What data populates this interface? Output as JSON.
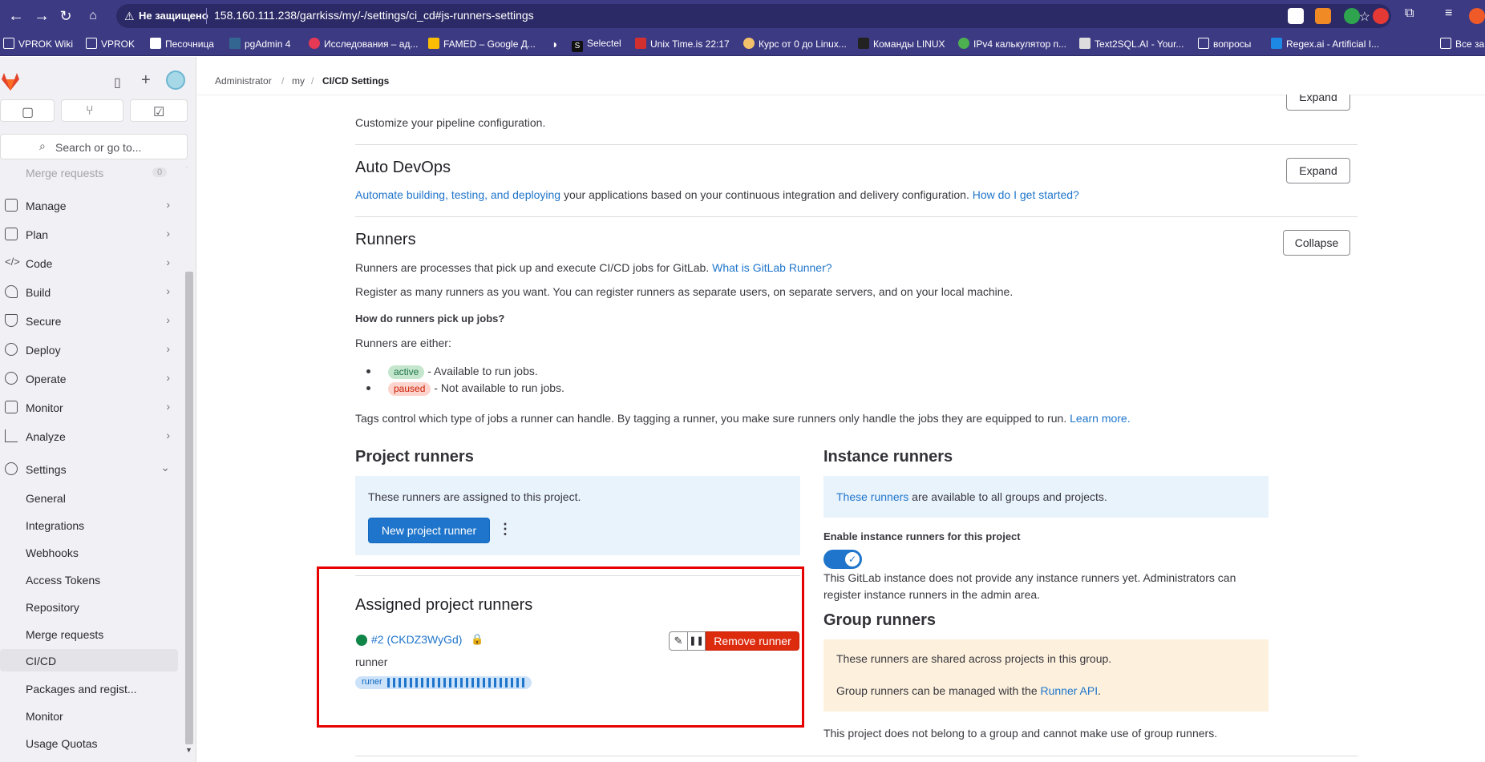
{
  "browser": {
    "security_label": "Не защищено",
    "url": "158.160.111.238/garrkiss/my/-/settings/ci_cd#js-runners-settings",
    "bookmarks": [
      "VPROK Wiki",
      "VPROK",
      "Песочница",
      "pgAdmin 4",
      "Исследования – ад...",
      "FAMED – Google Д...",
      "Selectel",
      "Unix Time.is 22:17",
      "Курс от 0 до Linux...",
      "Команды LINUX",
      "IPv4 калькулятор п...",
      "Text2SQL.AI - Your...",
      "вопросы",
      "Regex.ai - Artificial I...",
      "Все за"
    ]
  },
  "sidebar": {
    "search_placeholder": "Search or go to...",
    "partial_item": "Merge requests",
    "partial_count": "0",
    "items": [
      {
        "label": "Manage",
        "icon": "users-icon"
      },
      {
        "label": "Plan",
        "icon": "calendar-icon"
      },
      {
        "label": "Code",
        "icon": "code-icon"
      },
      {
        "label": "Build",
        "icon": "rocket-icon"
      },
      {
        "label": "Secure",
        "icon": "shield-icon"
      },
      {
        "label": "Deploy",
        "icon": "deploy-icon"
      },
      {
        "label": "Operate",
        "icon": "cloud-icon"
      },
      {
        "label": "Monitor",
        "icon": "monitor-icon"
      },
      {
        "label": "Analyze",
        "icon": "chart-icon"
      },
      {
        "label": "Settings",
        "icon": "gear-icon"
      }
    ],
    "settings_sub": [
      "General",
      "Integrations",
      "Webhooks",
      "Access Tokens",
      "Repository",
      "Merge requests",
      "CI/CD",
      "Packages and regist...",
      "Monitor",
      "Usage Quotas"
    ],
    "active_sub": "CI/CD"
  },
  "breadcrumb": {
    "a": "Administrator",
    "b": "my",
    "c": "CI/CD Settings"
  },
  "general_pipelines": {
    "desc": "Customize your pipeline configuration.",
    "button": "Expand"
  },
  "autodevops": {
    "title": "Auto DevOps",
    "link1": "Automate building, testing, and deploying",
    "text": " your applications based on your continuous integration and delivery configuration. ",
    "link2": "How do I get started?",
    "button": "Expand"
  },
  "runners": {
    "title": "Runners",
    "button": "Collapse",
    "p1": "Runners are processes that pick up and execute CI/CD jobs for GitLab. ",
    "p1_link": "What is GitLab Runner?",
    "p2": "Register as many runners as you want. You can register runners as separate users, on separate servers, and on your local machine.",
    "how_title": "How do runners pick up jobs?",
    "either": "Runners are either:",
    "active_badge": "active",
    "active_text": " - Available to run jobs.",
    "paused_badge": "paused",
    "paused_text": " - Not available to run jobs.",
    "tags": "Tags control which type of jobs a runner can handle. By tagging a runner, you make sure runners only handle the jobs they are equipped to run. ",
    "tags_link": "Learn more."
  },
  "project_runners": {
    "title": "Project runners",
    "desc": "These runners are assigned to this project.",
    "new_button": "New project runner"
  },
  "assigned": {
    "title": "Assigned project runners",
    "runner_id": "#2 (CKDZ3WyGd)",
    "runner_desc": "runner",
    "tag": "runer",
    "remove_button": "Remove runner"
  },
  "instance_runners": {
    "title": "Instance runners",
    "link": "These runners",
    "text": " are available to all groups and projects.",
    "toggle_label": "Enable instance runners for this project",
    "note1": "This GitLab instance does not provide any instance runners yet. Administrators can",
    "note2": "register instance runners in the admin area."
  },
  "group_runners": {
    "title": "Group runners",
    "p1": "These runners are shared across projects in this group.",
    "p2": "Group runners can be managed with the ",
    "p2_link": "Runner API",
    "p2_end": ".",
    "note": "This project does not belong to a group and cannot make use of group runners."
  },
  "colors": {
    "accent": "#1f75cb",
    "danger": "#dd2b0e",
    "highlight": "#e60000",
    "chrome": "#3d3a84"
  }
}
